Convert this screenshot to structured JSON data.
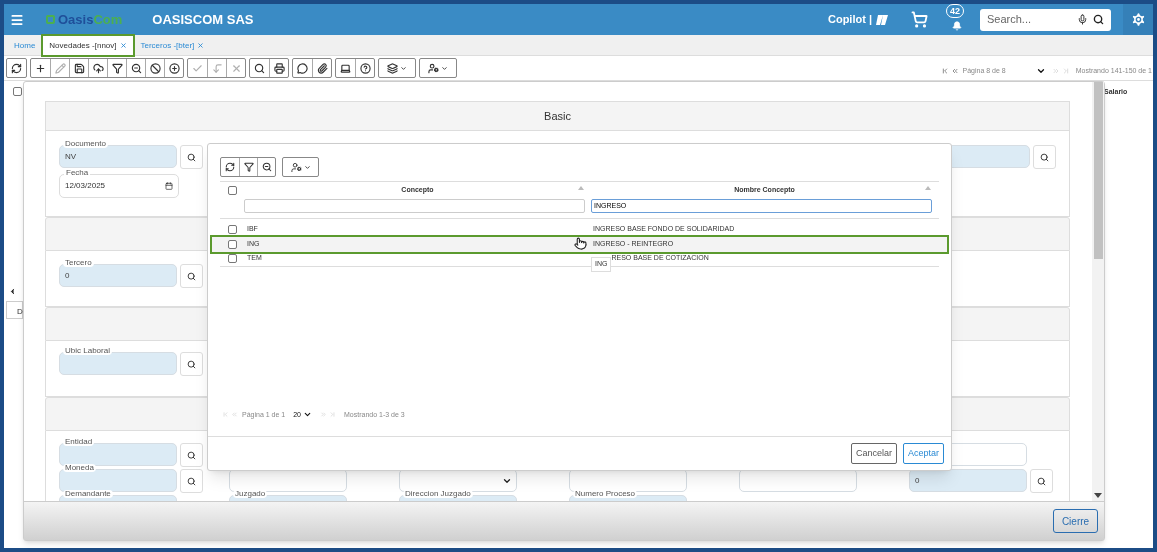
{
  "header": {
    "logo": {
      "part1": "Oasis",
      "part2": "Com"
    },
    "company": "OASISCOM SAS",
    "copilot": "Copilot |",
    "notifications": "42",
    "search": {
      "placeholder": "Search..."
    }
  },
  "tabs": [
    {
      "label": "Home",
      "selected": false,
      "closable": false,
      "highlighted": false
    },
    {
      "label": "Novedades -[nnov]",
      "selected": true,
      "closable": true,
      "highlighted": true
    },
    {
      "label": "Terceros -[bter]",
      "selected": false,
      "closable": true,
      "highlighted": false
    }
  ],
  "toolbar": {
    "groups": [
      [
        {
          "disabled": false
        }
      ],
      [
        {
          "disabled": false
        },
        {
          "disabled": true
        },
        {
          "disabled": false
        },
        {
          "disabled": false
        },
        {
          "disabled": false
        },
        {
          "disabled": false
        },
        {
          "disabled": false
        },
        {
          "disabled": false
        }
      ],
      [
        {
          "disabled": true
        },
        {
          "disabled": true
        },
        {
          "disabled": true
        }
      ],
      [
        {
          "disabled": false
        },
        {
          "disabled": false
        }
      ],
      [
        {
          "disabled": false
        },
        {
          "disabled": false
        }
      ],
      [
        {
          "disabled": false
        },
        {
          "disabled": false
        }
      ],
      [
        {
          "disabled": false
        }
      ],
      [
        {
          "disabled": false
        }
      ]
    ],
    "pagination": {
      "page": "Página 8 de 8",
      "showing": "Mostrando 141-150 de 1"
    }
  },
  "background": {
    "checkbox": {
      "checked": false
    },
    "column_header": "Salario",
    "tab": "D"
  },
  "form": {
    "title": "Basic",
    "documento": {
      "label": "Documento",
      "value": "NV"
    },
    "fecha": {
      "label": "Fecha",
      "value": "12/03/2025"
    },
    "tercero": {
      "label": "Tercero",
      "value": "0"
    },
    "ubic_laboral": {
      "label": "Ubic Laboral"
    },
    "entidad": {
      "label": "Entidad"
    },
    "moneda": {
      "label": "Moneda"
    },
    "right_value": "0",
    "bottom_labels": [
      "Demandante",
      "Juzgado",
      "Direccion Juzgado",
      "Numero Proceso"
    ],
    "close_button": "Cierre"
  },
  "dialog": {
    "columns": [
      {
        "label": "Concepto"
      },
      {
        "label": "Nombre Concepto",
        "filter": "INGRESO"
      }
    ],
    "select_all": {
      "checked": false
    },
    "rows": [
      {
        "code": "IBF",
        "name": "INGRESO BASE FONDO DE SOLIDARIDAD",
        "checked": false,
        "highlighted": false
      },
      {
        "code": "ING",
        "name": "INGRESO - REINTEGRO",
        "checked": false,
        "highlighted": true
      },
      {
        "code": "TEM",
        "name": "RESO BASE DE COTIZACION",
        "checked": false,
        "highlighted": false,
        "tooltip": "ING"
      }
    ],
    "pagination": {
      "page": "Página 1 de 1",
      "size": "20",
      "showing": "Mostrando 1-3 de 3"
    },
    "buttons": {
      "cancel": "Cancelar",
      "accept": "Aceptar"
    }
  }
}
